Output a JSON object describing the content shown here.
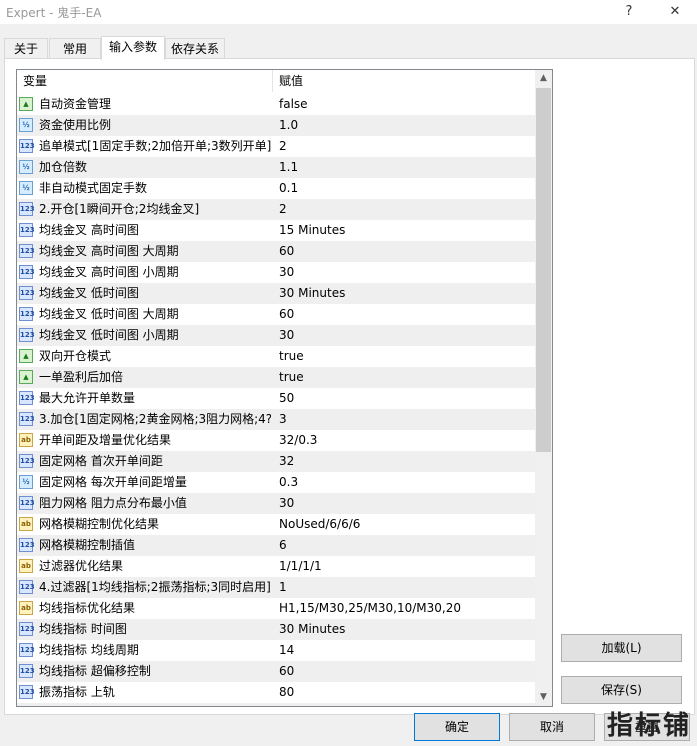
{
  "window": {
    "title": "Expert - 鬼手-EA",
    "help_label": "?",
    "close_label": "✕"
  },
  "tabs": [
    {
      "label": "关于"
    },
    {
      "label": "常用"
    },
    {
      "label": "输入参数"
    },
    {
      "label": "依存关系"
    }
  ],
  "grid": {
    "col_variable": "变量",
    "col_value": "赋值",
    "rows": [
      {
        "type": "bool",
        "name": "自动资金管理",
        "value": "false"
      },
      {
        "type": "dbl",
        "name": "资金使用比例",
        "value": "1.0"
      },
      {
        "type": "int",
        "name": "追单模式[1固定手数;2加倍开单;3数列开单]",
        "value": "2"
      },
      {
        "type": "dbl",
        "name": "加仓倍数",
        "value": "1.1"
      },
      {
        "type": "dbl",
        "name": "非自动模式固定手数",
        "value": "0.1"
      },
      {
        "type": "int",
        "name": "2.开仓[1瞬间开仓;2均线金叉]",
        "value": "2"
      },
      {
        "type": "enum",
        "name": "均线金叉 高时间图",
        "value": "15 Minutes"
      },
      {
        "type": "int",
        "name": "均线金叉 高时间图 大周期",
        "value": "60"
      },
      {
        "type": "int",
        "name": "均线金叉 高时间图 小周期",
        "value": "30"
      },
      {
        "type": "enum",
        "name": "均线金叉 低时间图",
        "value": "30 Minutes"
      },
      {
        "type": "int",
        "name": "均线金叉 低时间图 大周期",
        "value": "60"
      },
      {
        "type": "int",
        "name": "均线金叉 低时间图 小周期",
        "value": "30"
      },
      {
        "type": "bool",
        "name": "双向开仓模式",
        "value": "true"
      },
      {
        "type": "bool",
        "name": "一单盈利后加倍",
        "value": "true"
      },
      {
        "type": "int",
        "name": "最大允许开单数量",
        "value": "50"
      },
      {
        "type": "int",
        "name": "3.加仓[1固定网格;2黄金网格;3阻力网格;4?...",
        "value": "3"
      },
      {
        "type": "str",
        "name": "开单间距及增量优化结果",
        "value": "32/0.3"
      },
      {
        "type": "int",
        "name": "固定网格 首次开单间距",
        "value": "32"
      },
      {
        "type": "dbl",
        "name": "固定网格 每次开单间距增量",
        "value": "0.3"
      },
      {
        "type": "int",
        "name": "阻力网格 阻力点分布最小值",
        "value": "30"
      },
      {
        "type": "str",
        "name": "网格模糊控制优化结果",
        "value": "NoUsed/6/6/6"
      },
      {
        "type": "int",
        "name": "网格模糊控制插值",
        "value": "6"
      },
      {
        "type": "str",
        "name": "过滤器优化结果",
        "value": "1/1/1/1"
      },
      {
        "type": "int",
        "name": "4.过滤器[1均线指标;2振荡指标;3同时启用]",
        "value": "1"
      },
      {
        "type": "str",
        "name": "均线指标优化结果",
        "value": "H1,15/M30,25/M30,10/M30,20"
      },
      {
        "type": "enum",
        "name": "均线指标 时间图",
        "value": "30 Minutes"
      },
      {
        "type": "int",
        "name": "均线指标 均线周期",
        "value": "14"
      },
      {
        "type": "int",
        "name": "均线指标 超偏移控制",
        "value": "60"
      },
      {
        "type": "int",
        "name": "振荡指标 上轨",
        "value": "80"
      },
      {
        "type": "int",
        "name": "",
        "value": ""
      }
    ]
  },
  "icons": {
    "bool": "check-chart-icon",
    "dbl": "v2-icon",
    "int": "123-icon",
    "str": "ab-icon",
    "enum": "123-icon"
  },
  "icon_text": {
    "bool": "▲",
    "dbl": "½",
    "int": "123",
    "str": "ab",
    "enum": "123"
  },
  "buttons": {
    "load": "加载(L)",
    "save": "保存(S)",
    "ok": "确定",
    "cancel": "取消",
    "reset": "重置"
  },
  "watermark": "指标铺"
}
